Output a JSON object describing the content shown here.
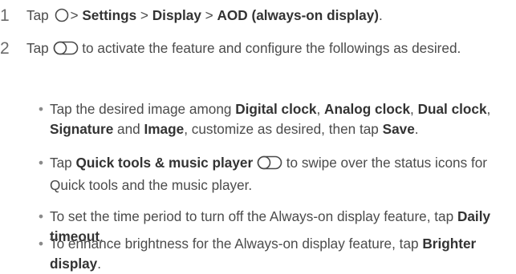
{
  "steps": [
    {
      "number": "1",
      "pre": "Tap",
      "home_icon": "circle-icon",
      "sep": ">",
      "settings": "Settings",
      "display": "Display",
      "aod": "AOD (always-on display)",
      "end": "."
    },
    {
      "number": "2",
      "pre": "Tap",
      "toggle_icon": "toggle-switch-icon",
      "post": "to activate the feature and configure the followings as desired."
    }
  ],
  "bullets": [
    {
      "t1": "Tap the desired image among ",
      "b1": "Digital clock",
      "t2": ", ",
      "b2": "Analog clock",
      "t3": ", ",
      "b3": "Dual clock",
      "t4": ", ",
      "b4": "Signature",
      "t5": " and ",
      "b5": "Image",
      "t6": ", customize as desired, then tap ",
      "b6": "Save",
      "t7": "."
    },
    {
      "t1": "Tap ",
      "b1": "Quick tools & music player",
      "t2": " to swipe over the status icons for Quick tools and the music player."
    },
    {
      "t1": "To set the time period to turn off the Always-on display feature, tap ",
      "b1": "Daily timeout",
      "t2": "."
    },
    {
      "t1": "To enhance brightness for the Always-on display feature, tap ",
      "b1": "Brighter display",
      "t2": "."
    }
  ],
  "bullet_char": "•"
}
